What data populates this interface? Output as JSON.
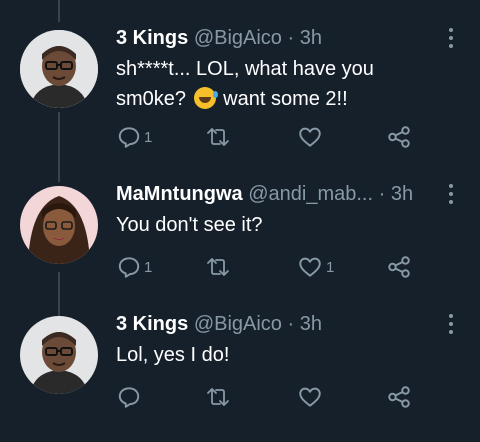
{
  "tweets": [
    {
      "name": "3 Kings",
      "handle": "@BigAico",
      "separator": "·",
      "time": "3h",
      "text_before_emoji": "sh****t... LOL, what have you sm0ke?",
      "emoji": "rolling-on-floor-laughing",
      "text_after_emoji": " want some 2!!",
      "reply_count": "1",
      "retweet_count": "",
      "like_count": "",
      "avatar": "man-with-glasses-avatar"
    },
    {
      "name": "MaMntungwa",
      "handle": "@andi_mab...",
      "separator": "·",
      "time": "3h",
      "text": "You don't see it?",
      "reply_count": "1",
      "retweet_count": "",
      "like_count": "1",
      "avatar": "woman-with-braids-avatar"
    },
    {
      "name": "3 Kings",
      "handle": "@BigAico",
      "separator": "·",
      "time": "3h",
      "text": "Lol, yes I do!",
      "reply_count": "",
      "retweet_count": "",
      "like_count": "",
      "avatar": "man-with-glasses-avatar"
    }
  ],
  "icons": {
    "reply": "reply-icon",
    "retweet": "retweet-icon",
    "like": "heart-icon",
    "share": "share-icon",
    "more": "more-vertical-icon"
  },
  "colors": {
    "background": "#15202b",
    "muted": "#8899a6",
    "text": "#ffffff",
    "thread_line": "#38444d"
  }
}
